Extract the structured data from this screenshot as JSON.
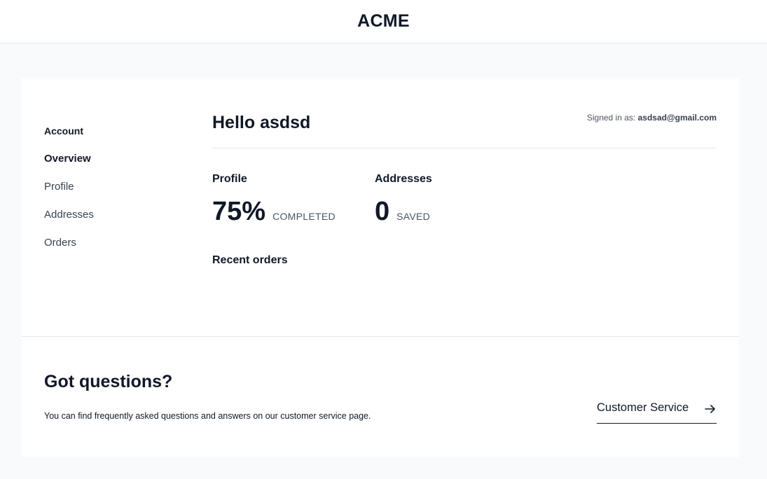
{
  "header": {
    "brand": "ACME"
  },
  "sidebar": {
    "title": "Account",
    "items": [
      {
        "label": "Overview",
        "active": true
      },
      {
        "label": "Profile",
        "active": false
      },
      {
        "label": "Addresses",
        "active": false
      },
      {
        "label": "Orders",
        "active": false
      }
    ]
  },
  "main": {
    "greeting": "Hello asdsd",
    "signed_in_label": "Signed in as:",
    "signed_in_email": "asdsad@gmail.com",
    "profile": {
      "title": "Profile",
      "value": "75%",
      "suffix": "COMPLETED"
    },
    "addresses": {
      "title": "Addresses",
      "value": "0",
      "suffix": "SAVED"
    },
    "recent_orders_title": "Recent orders"
  },
  "help": {
    "title": "Got questions?",
    "text": "You can find frequently asked questions and answers on our customer service page.",
    "link_label": "Customer Service",
    "link_icon": "arrow-right-icon"
  },
  "colors": {
    "page_bg": "#f9fafb",
    "card_bg": "#ffffff",
    "text": "#111827",
    "muted": "#4b5563",
    "border": "#e5e7eb"
  }
}
